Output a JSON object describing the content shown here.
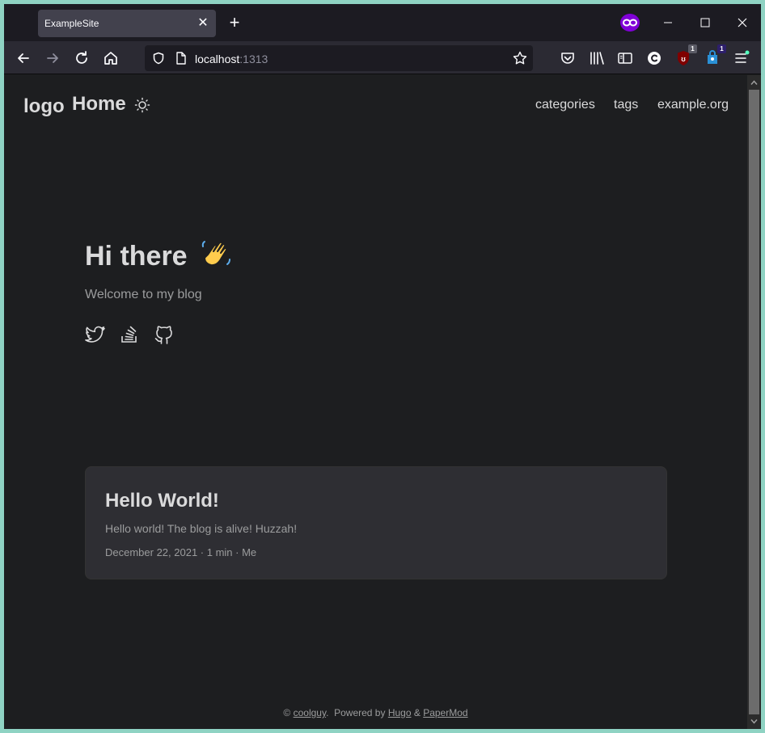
{
  "browser": {
    "tab_title": "ExampleSite",
    "tab_close": "✕",
    "new_tab": "+",
    "url_host": "localhost",
    "url_port": ":1313",
    "ublock_badge": "1",
    "ext_badge": "1",
    "ublock_badge_color": "#5b5b66",
    "ext_badge_color": "#2d1f6b",
    "private_color": "#8000d7"
  },
  "site": {
    "logo": "logo",
    "home": "Home",
    "menu": [
      "categories",
      "tags",
      "example.org"
    ]
  },
  "hero": {
    "title": "Hi there",
    "subtitle": "Welcome to my blog"
  },
  "post": {
    "title": "Hello World!",
    "summary": "Hello world! The blog is alive! Huzzah!",
    "meta": "December 22, 2021 · 1 min · Me"
  },
  "footer": {
    "copyright": "©",
    "author": "coolguy",
    "dot": ".",
    "powered_by": "Powered by",
    "hugo": "Hugo",
    "amp": "&",
    "papermod": "PaperMod"
  }
}
